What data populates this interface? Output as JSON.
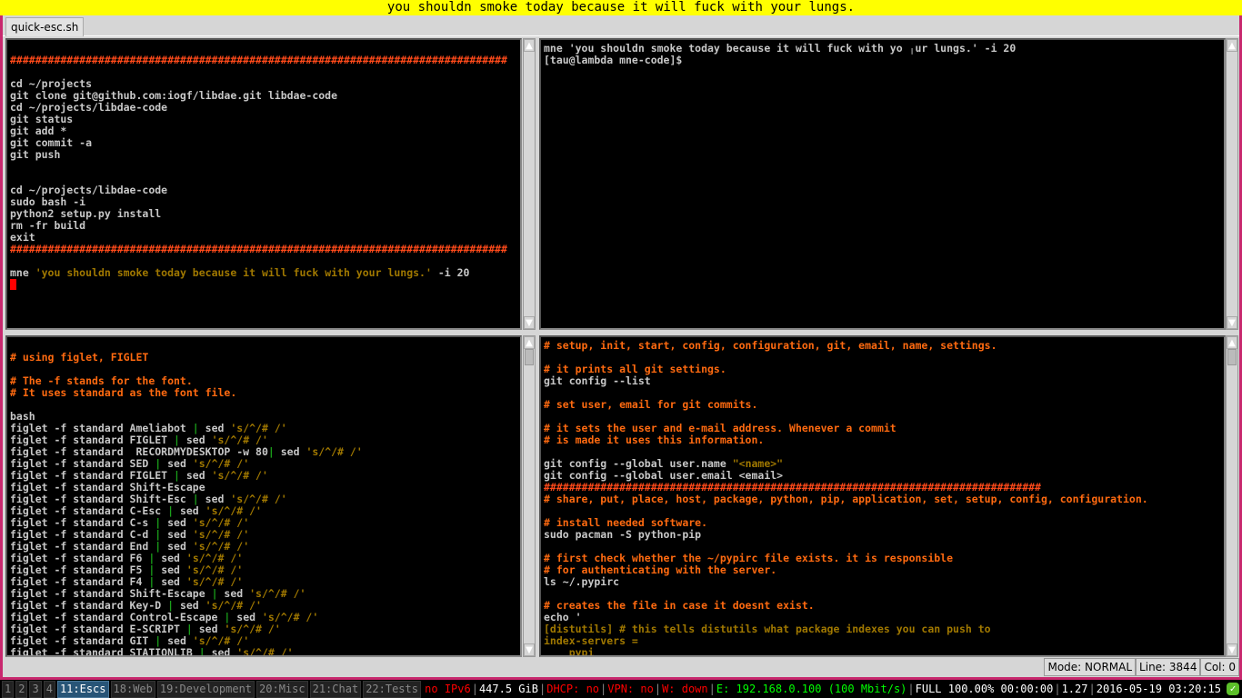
{
  "topbar": {
    "message": "you shouldn smoke today because it will fuck with your lungs."
  },
  "tab": {
    "label": "quick-esc.sh"
  },
  "colors": {
    "comment": "#ff6a10",
    "hashline": "#ff4a1a",
    "string": "#a07800",
    "pipe": "#1aa01a",
    "text": "#c8c8c8",
    "active_workspace": "#285577",
    "border": "#c8286e"
  },
  "panes": {
    "top_left": [
      [],
      [
        [
          "###############################################################################",
          "h"
        ]
      ],
      [],
      [
        [
          "cd ~/projects",
          "n"
        ]
      ],
      [
        [
          "git clone git@github.com:iogf/libdae.git libdae-code",
          "n"
        ]
      ],
      [
        [
          "cd ~/projects/libdae-code",
          "n"
        ]
      ],
      [
        [
          "git status",
          "n"
        ]
      ],
      [
        [
          "git add *",
          "n"
        ]
      ],
      [
        [
          "git commit -a",
          "n"
        ]
      ],
      [
        [
          "git push",
          "n"
        ]
      ],
      [],
      [],
      [
        [
          "cd ~/projects/libdae-code",
          "n"
        ]
      ],
      [
        [
          "sudo bash -i",
          "n"
        ]
      ],
      [
        [
          "python2 setup.py install",
          "n"
        ]
      ],
      [
        [
          "rm -fr build",
          "n"
        ]
      ],
      [
        [
          "exit",
          "n"
        ]
      ],
      [
        [
          "###############################################################################",
          "h"
        ]
      ],
      [],
      [
        [
          "mne ",
          "n"
        ],
        [
          "'you shouldn smoke today because it will fuck with your lungs.'",
          "s"
        ],
        [
          " -i 20",
          "n"
        ]
      ]
    ],
    "top_right": [
      [
        [
          "mne 'you shouldn smoke today because it will fuck with yo ╷ur lungs.' -i 20",
          "n"
        ]
      ],
      [
        [
          "[tau@lambda mne-code]$",
          "n"
        ]
      ]
    ],
    "bottom_left": [
      [],
      [
        [
          "# using figlet, FIGLET",
          "c"
        ]
      ],
      [],
      [
        [
          "# The -f stands for the font.",
          "c"
        ]
      ],
      [
        [
          "# It uses standard as the font file.",
          "c"
        ]
      ],
      [],
      [
        [
          "bash",
          "n"
        ]
      ],
      [
        [
          "figlet -f standard Ameliabot ",
          "n"
        ],
        [
          "|",
          "p"
        ],
        [
          " sed ",
          "n"
        ],
        [
          "'s/^/# /'",
          "s"
        ]
      ],
      [
        [
          "figlet -f standard FIGLET ",
          "n"
        ],
        [
          "|",
          "p"
        ],
        [
          " sed ",
          "n"
        ],
        [
          "'s/^/# /'",
          "s"
        ]
      ],
      [
        [
          "figlet -f standard  RECORDMYDESKTOP -w 80",
          "n"
        ],
        [
          "|",
          "p"
        ],
        [
          " sed ",
          "n"
        ],
        [
          "'s/^/# /'",
          "s"
        ]
      ],
      [
        [
          "figlet -f standard SED ",
          "n"
        ],
        [
          "|",
          "p"
        ],
        [
          " sed ",
          "n"
        ],
        [
          "'s/^/# /'",
          "s"
        ]
      ],
      [
        [
          "figlet -f standard FIGLET ",
          "n"
        ],
        [
          "|",
          "p"
        ],
        [
          " sed ",
          "n"
        ],
        [
          "'s/^/# /'",
          "s"
        ]
      ],
      [
        [
          "figlet -f standard Shift-Escape",
          "n"
        ]
      ],
      [
        [
          "figlet -f standard Shift-Esc ",
          "n"
        ],
        [
          "|",
          "p"
        ],
        [
          " sed ",
          "n"
        ],
        [
          "'s/^/# /'",
          "s"
        ]
      ],
      [
        [
          "figlet -f standard C-Esc ",
          "n"
        ],
        [
          "|",
          "p"
        ],
        [
          " sed ",
          "n"
        ],
        [
          "'s/^/# /'",
          "s"
        ]
      ],
      [
        [
          "figlet -f standard C-s ",
          "n"
        ],
        [
          "|",
          "p"
        ],
        [
          " sed ",
          "n"
        ],
        [
          "'s/^/# /'",
          "s"
        ]
      ],
      [
        [
          "figlet -f standard C-d ",
          "n"
        ],
        [
          "|",
          "p"
        ],
        [
          " sed ",
          "n"
        ],
        [
          "'s/^/# /'",
          "s"
        ]
      ],
      [
        [
          "figlet -f standard End ",
          "n"
        ],
        [
          "|",
          "p"
        ],
        [
          " sed ",
          "n"
        ],
        [
          "'s/^/# /'",
          "s"
        ]
      ],
      [
        [
          "figlet -f standard F6 ",
          "n"
        ],
        [
          "|",
          "p"
        ],
        [
          " sed ",
          "n"
        ],
        [
          "'s/^/# /'",
          "s"
        ]
      ],
      [
        [
          "figlet -f standard F5 ",
          "n"
        ],
        [
          "|",
          "p"
        ],
        [
          " sed ",
          "n"
        ],
        [
          "'s/^/# /'",
          "s"
        ]
      ],
      [
        [
          "figlet -f standard F4 ",
          "n"
        ],
        [
          "|",
          "p"
        ],
        [
          " sed ",
          "n"
        ],
        [
          "'s/^/# /'",
          "s"
        ]
      ],
      [
        [
          "figlet -f standard Shift-Escape ",
          "n"
        ],
        [
          "|",
          "p"
        ],
        [
          " sed ",
          "n"
        ],
        [
          "'s/^/# /'",
          "s"
        ]
      ],
      [
        [
          "figlet -f standard Key-D ",
          "n"
        ],
        [
          "|",
          "p"
        ],
        [
          " sed ",
          "n"
        ],
        [
          "'s/^/# /'",
          "s"
        ]
      ],
      [
        [
          "figlet -f standard Control-Escape ",
          "n"
        ],
        [
          "|",
          "p"
        ],
        [
          " sed ",
          "n"
        ],
        [
          "'s/^/# /'",
          "s"
        ]
      ],
      [
        [
          "figlet -f standard E-SCRIPT ",
          "n"
        ],
        [
          "|",
          "p"
        ],
        [
          " sed ",
          "n"
        ],
        [
          "'s/^/# /'",
          "s"
        ]
      ],
      [
        [
          "figlet -f standard GIT ",
          "n"
        ],
        [
          "|",
          "p"
        ],
        [
          " sed ",
          "n"
        ],
        [
          "'s/^/# /'",
          "s"
        ]
      ],
      [
        [
          "figlet -f standard STATIONLIB ",
          "n"
        ],
        [
          "|",
          "p"
        ],
        [
          " sed ",
          "n"
        ],
        [
          "'s/^/# /'",
          "s"
        ]
      ]
    ],
    "bottom_right": [
      [
        [
          "# setup, init, start, config, configuration, git, email, name, settings.",
          "c"
        ]
      ],
      [],
      [
        [
          "# it prints all git settings.",
          "c"
        ]
      ],
      [
        [
          "git config --list",
          "n"
        ]
      ],
      [],
      [
        [
          "# set user, email for git commits.",
          "c"
        ]
      ],
      [],
      [
        [
          "# it sets the user and e-mail address. Whenever a commit",
          "c"
        ]
      ],
      [
        [
          "# is made it uses this information.",
          "c"
        ]
      ],
      [],
      [
        [
          "git config --global user.name ",
          "n"
        ],
        [
          "\"<name>\"",
          "s"
        ]
      ],
      [
        [
          "git config --global user.email <email>",
          "n"
        ]
      ],
      [
        [
          "###############################################################################",
          "h"
        ]
      ],
      [
        [
          "# share, put, place, host, package, python, pip, application, set, setup, config, configuration.",
          "c"
        ]
      ],
      [],
      [
        [
          "# install needed software.",
          "c"
        ]
      ],
      [
        [
          "sudo pacman -S python-pip",
          "n"
        ]
      ],
      [],
      [
        [
          "# first check whether the ~/pypirc file exists. it is responsible",
          "c"
        ]
      ],
      [
        [
          "# for authenticating with the server.",
          "c"
        ]
      ],
      [
        [
          "ls ~/.pypirc",
          "n"
        ]
      ],
      [],
      [
        [
          "# creates the file in case it doesnt exist.",
          "c"
        ]
      ],
      [
        [
          "echo '",
          "n"
        ]
      ],
      [
        [
          "[distutils] # this tells distutils what package indexes you can push to",
          "s"
        ]
      ],
      [
        [
          "index-servers =",
          "s"
        ]
      ],
      [
        [
          "    pypi",
          "s"
        ]
      ]
    ]
  },
  "status": {
    "mode": "Mode: NORMAL",
    "line": "Line: 3844",
    "col": "Col: 0"
  },
  "workspaces": [
    {
      "label": "1",
      "active": false
    },
    {
      "label": "2",
      "active": false
    },
    {
      "label": "3",
      "active": false
    },
    {
      "label": "4",
      "active": false
    },
    {
      "label": "11:Escs",
      "active": true
    },
    {
      "label": "18:Web",
      "active": false
    },
    {
      "label": "19:Development",
      "active": false
    },
    {
      "label": "20:Misc",
      "active": false
    },
    {
      "label": "21:Chat",
      "active": false
    },
    {
      "label": "22:Tests",
      "active": false
    }
  ],
  "statusbar": [
    {
      "text": "no IPv6",
      "color": "#ff0000"
    },
    {
      "text": "447.5 GiB",
      "color": "#ffffff"
    },
    {
      "text": "DHCP: no",
      "color": "#ff0000"
    },
    {
      "text": "VPN: no",
      "color": "#ff0000"
    },
    {
      "text": "W: down",
      "color": "#ff0000"
    },
    {
      "text": "E: 192.168.0.100 (100 Mbit/s)",
      "color": "#00ff00"
    },
    {
      "text": "FULL 100.00% 00:00:00",
      "color": "#ffffff"
    },
    {
      "text": "1.27",
      "color": "#ffffff"
    },
    {
      "text": "2016-05-19 03:20:15",
      "color": "#ffffff"
    }
  ],
  "tray": {
    "icon": "check-icon"
  }
}
